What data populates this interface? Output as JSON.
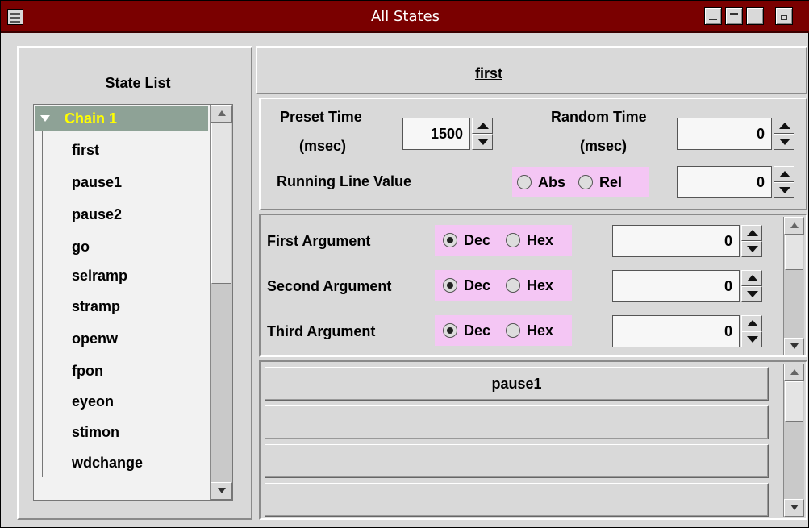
{
  "window": {
    "title": "All States"
  },
  "state_list": {
    "title": "State List",
    "chain_label": "Chain 1",
    "items": [
      "first",
      "pause1",
      "pause2",
      "go",
      "selramp",
      "stramp",
      "openw",
      "fpon",
      "eyeon",
      "stimon",
      "wdchange"
    ]
  },
  "state": {
    "name": "first"
  },
  "timing": {
    "preset_label_line1": "Preset Time",
    "preset_label_line2": "(msec)",
    "preset_value": "1500",
    "random_label_line1": "Random Time",
    "random_label_line2": "(msec)",
    "random_value": "0",
    "running_label": "Running Line Value",
    "abs_label": "Abs",
    "rel_label": "Rel",
    "running_value": "0"
  },
  "arguments": [
    {
      "label": "First Argument",
      "dec": "Dec",
      "hex": "Hex",
      "value": "0"
    },
    {
      "label": "Second Argument",
      "dec": "Dec",
      "hex": "Hex",
      "value": "0"
    },
    {
      "label": "Third Argument",
      "dec": "Dec",
      "hex": "Hex",
      "value": "0"
    }
  ],
  "transitions": [
    "pause1",
    "",
    "",
    ""
  ],
  "colors": {
    "titlebar": "#7a0000",
    "chain_highlight": "#8ea296",
    "chain_text": "#ffff00",
    "radio_group_bg": "#f4c6f4"
  }
}
